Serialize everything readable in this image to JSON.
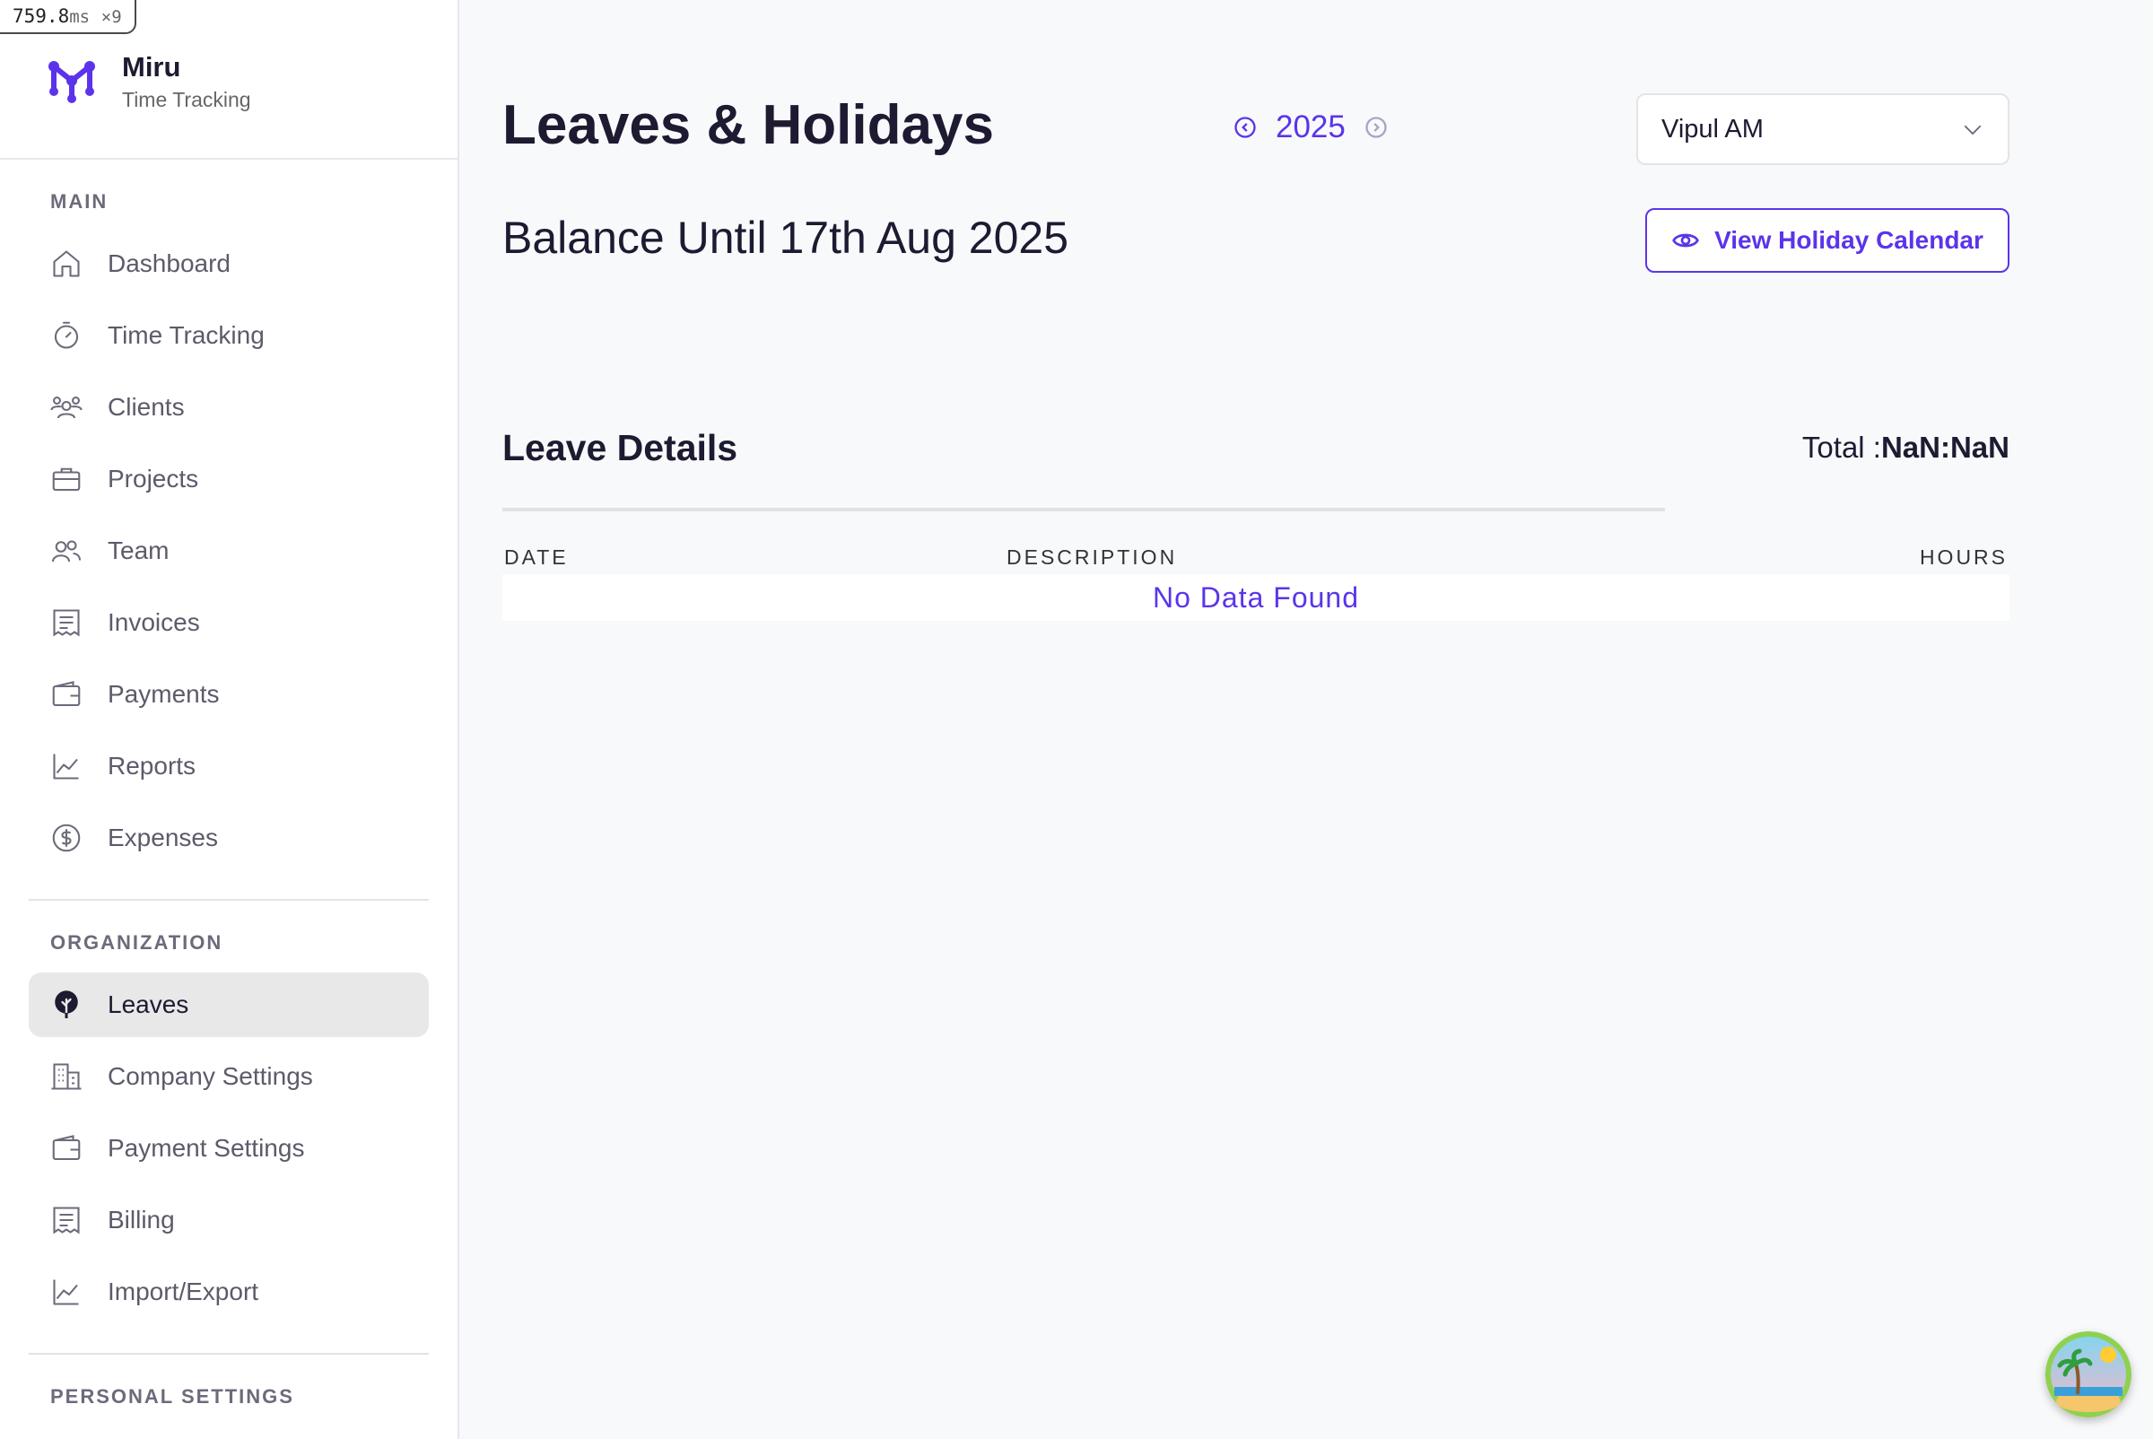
{
  "perf": {
    "value": "759.8",
    "unit": "ms",
    "multiplier": "×9"
  },
  "brand": {
    "name": "Miru",
    "subtitle": "Time Tracking",
    "logo_icon": "miru-logo-icon",
    "color": "#5b34ea"
  },
  "sidebar": {
    "sections": [
      {
        "label": "MAIN",
        "items": [
          {
            "label": "Dashboard",
            "icon": "home-icon"
          },
          {
            "label": "Time Tracking",
            "icon": "stopwatch-icon"
          },
          {
            "label": "Clients",
            "icon": "clients-icon"
          },
          {
            "label": "Projects",
            "icon": "briefcase-icon"
          },
          {
            "label": "Team",
            "icon": "team-icon"
          },
          {
            "label": "Invoices",
            "icon": "invoice-icon"
          },
          {
            "label": "Payments",
            "icon": "wallet-icon"
          },
          {
            "label": "Reports",
            "icon": "chart-line-icon"
          },
          {
            "label": "Expenses",
            "icon": "dollar-circle-icon"
          }
        ]
      },
      {
        "label": "ORGANIZATION",
        "items": [
          {
            "label": "Leaves",
            "icon": "tree-icon",
            "active": true
          },
          {
            "label": "Company Settings",
            "icon": "building-icon"
          },
          {
            "label": "Payment Settings",
            "icon": "wallet-icon"
          },
          {
            "label": "Billing",
            "icon": "invoice-icon"
          },
          {
            "label": "Import/Export",
            "icon": "chart-line-icon"
          }
        ]
      },
      {
        "label": "PERSONAL SETTINGS",
        "items": []
      }
    ]
  },
  "main": {
    "title": "Leaves & Holidays",
    "year": "2025",
    "employee_select": {
      "value": "Vipul AM"
    },
    "balance_title": "Balance Until 17th Aug 2025",
    "calendar_button": "View Holiday Calendar",
    "details_title": "Leave Details",
    "total_label": "Total :",
    "total_value": "NaN:NaN",
    "table": {
      "columns": [
        "DATE",
        "DESCRIPTION",
        "HOURS"
      ],
      "empty_text": "No Data Found"
    }
  },
  "colors": {
    "accent": "#5b34ea",
    "text": "#1d1a31",
    "muted": "#5b5b6b",
    "background": "#f8f9fb"
  },
  "fab": {
    "icon": "beach-island-icon"
  }
}
